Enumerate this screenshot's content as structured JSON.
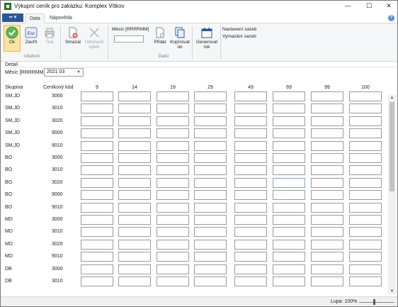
{
  "window": {
    "title": "Výkupní ceník pro zakázku: Komplex Vítkov"
  },
  "titlebar": {
    "minimize": "—",
    "maximize": "☐",
    "close": "✕"
  },
  "tabs": {
    "file_label": "▪▪ ▾",
    "items": [
      "Data",
      "Nápověda"
    ],
    "help": "?"
  },
  "ribbon": {
    "ok": "Ok",
    "close": "Zavřít",
    "esc_key": "Esc",
    "print": "Tisk",
    "delete": "Smazat",
    "remove_selection": [
      "Odstranit",
      "výběr"
    ],
    "mesic_label": "Měsíc [RRRRMM]",
    "add": "Přidat",
    "copy_to": [
      "Kopírovat",
      "do"
    ],
    "generate_year": [
      "Generovat",
      "rok"
    ],
    "settings_rates": "Nastavení sazeb",
    "clear_rates": "Vymazání sazeb",
    "group_save": "Uložení",
    "group_other": "Další"
  },
  "detail": {
    "label": "Detail",
    "mesic_label": "Měsíc [RRRRMM]",
    "mesic_value": "2021 03"
  },
  "grid": {
    "col_skupina": "Skupina",
    "col_kod": "Ceníkový kód",
    "columns": [
      "9",
      "14",
      "19",
      "29",
      "49",
      "69",
      "99",
      "100"
    ],
    "rows": [
      {
        "skupina": "SM,JD",
        "kod": "3000"
      },
      {
        "skupina": "SM,JD",
        "kod": "3010"
      },
      {
        "skupina": "SM,JD",
        "kod": "3020"
      },
      {
        "skupina": "SM,JD",
        "kod": "9000"
      },
      {
        "skupina": "SM,JD",
        "kod": "9010"
      },
      {
        "skupina": "BO",
        "kod": "3000"
      },
      {
        "skupina": "BO",
        "kod": "3010"
      },
      {
        "skupina": "BO",
        "kod": "3020"
      },
      {
        "skupina": "BO",
        "kod": "9000"
      },
      {
        "skupina": "BO",
        "kod": "9010"
      },
      {
        "skupina": "MD",
        "kod": "3000"
      },
      {
        "skupina": "MD",
        "kod": "3010"
      },
      {
        "skupina": "MD",
        "kod": "3020"
      },
      {
        "skupina": "MD",
        "kod": "9010"
      },
      {
        "skupina": "DB",
        "kod": "3000"
      },
      {
        "skupina": "DB",
        "kod": "3010"
      }
    ],
    "focused_cell": {
      "row": 7,
      "col": 5
    }
  },
  "status": {
    "zoom_label": "Lupa: 100%"
  },
  "colors": {
    "accent": "#2b579a",
    "ok_highlight": "#fbe3a4",
    "ok_check": "#5cb85c"
  }
}
